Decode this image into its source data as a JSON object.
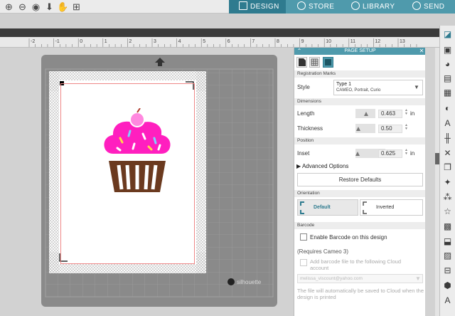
{
  "toolbar": {
    "icons": [
      "zoom-in-icon",
      "zoom-out-icon",
      "zoom-fit-icon",
      "move-down-icon",
      "pan-hand-icon",
      "fit-page-icon"
    ]
  },
  "tabs": {
    "design": "DESIGN",
    "store": "STORE",
    "library": "LIBRARY",
    "send": "SEND"
  },
  "ruler": {
    "labels": [
      "-2",
      "-1",
      "0",
      "1",
      "2",
      "3",
      "4",
      "5",
      "6",
      "7",
      "8",
      "9",
      "10",
      "11",
      "12",
      "13"
    ]
  },
  "mat": {
    "brand": "silhouette"
  },
  "panel": {
    "title": "PAGE SETUP",
    "registration": {
      "section": "Registration Marks",
      "style_label": "Style",
      "style_value": "Type 1",
      "style_desc": "CAMEO, Portrait, Curio"
    },
    "dimensions": {
      "section": "Dimensions",
      "length_label": "Length",
      "length_value": "0.463",
      "thickness_label": "Thickness",
      "thickness_value": "0.50",
      "unit": "in"
    },
    "position": {
      "section": "Position",
      "inset_label": "Inset",
      "inset_value": "0.625",
      "unit": "in"
    },
    "advanced": "Advanced Options",
    "restore": "Restore Defaults",
    "orientation": {
      "section": "Orientation",
      "default": "Default",
      "inverted": "Inverted"
    },
    "barcode": {
      "section": "Barcode",
      "enable": "Enable Barcode on this design",
      "requires": "(Requires Cameo 3)",
      "add_file": "Add barcode file to the following Cloud account",
      "email": "melissa_viscount@yahoo.com",
      "note": "The file will automatically be saved to Cloud when the design is printed"
    }
  },
  "colors": {
    "accent": "#4f9aac",
    "accent_dark": "#2f7b8f",
    "frosting": "#ff1fbf",
    "wrapper": "#6b3a1f",
    "cutline": "#ee8888"
  }
}
